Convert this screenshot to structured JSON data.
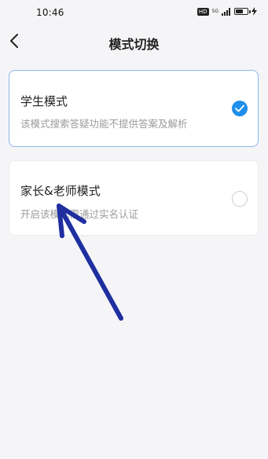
{
  "status_bar": {
    "time": "10:46",
    "hd_badge": "HD",
    "network": "5G",
    "battery_level": 0.7
  },
  "nav": {
    "title": "模式切换",
    "back_icon": "chevron-left-icon"
  },
  "modes": [
    {
      "title": "学生模式",
      "description": "该模式搜索答疑功能不提供答案及解析",
      "selected": true
    },
    {
      "title": "家长&老师模式",
      "description": "开启该模式需通过实名认证",
      "selected": false
    }
  ],
  "colors": {
    "accent": "#1e8fea",
    "selected_border": "#8bb8ea",
    "annotation_arrow": "#1f2fa0",
    "background": "#f5f5f7"
  }
}
